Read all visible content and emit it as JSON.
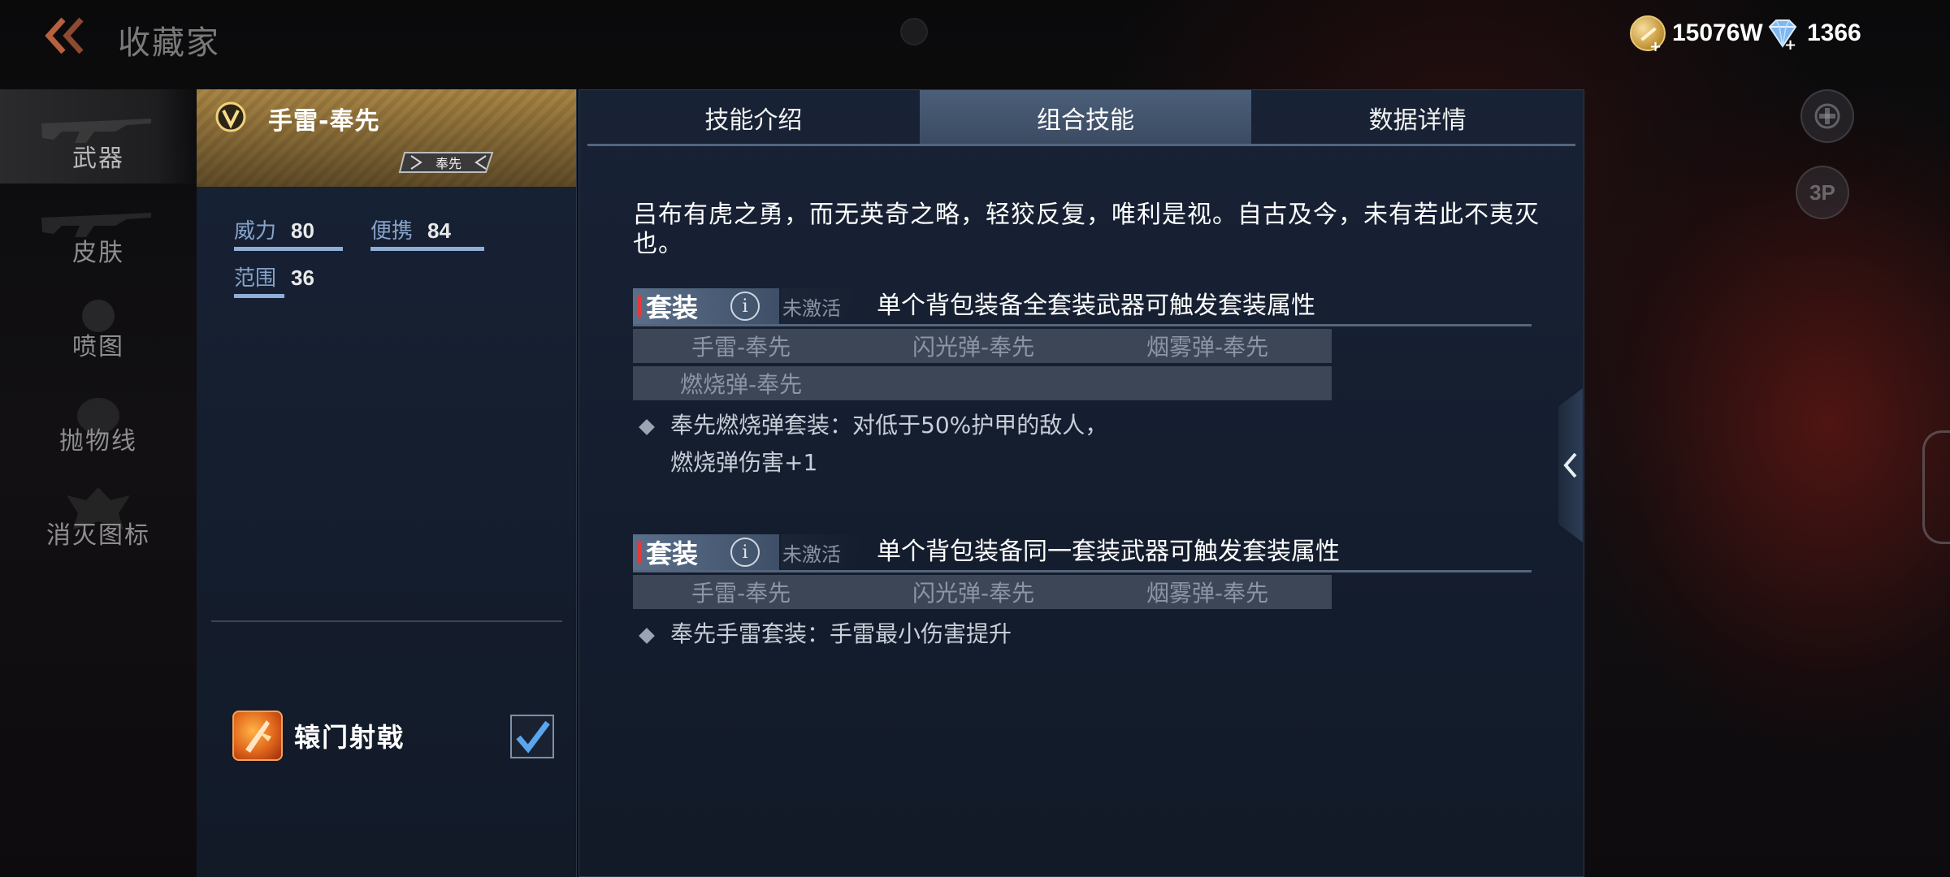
{
  "topbar": {
    "title": "收藏家",
    "gold_amount": "15076W",
    "gem_amount": "1366"
  },
  "categories": [
    {
      "label": "武器",
      "icon": "rifle-icon",
      "active": true
    },
    {
      "label": "皮肤",
      "icon": "rifle-icon",
      "active": false
    },
    {
      "label": "喷图",
      "icon": "spray-icon",
      "active": false
    },
    {
      "label": "抛物线",
      "icon": "grenade-icon",
      "active": false
    },
    {
      "label": "消灭图标",
      "icon": "emblem-icon",
      "active": false
    }
  ],
  "weapon": {
    "name": "手雷-奉先",
    "series": "奉先",
    "stats": [
      {
        "label": "威力",
        "value": "80"
      },
      {
        "label": "便携",
        "value": "84"
      },
      {
        "label": "范围",
        "value": "36"
      }
    ],
    "trait": {
      "name": "辕门射戟",
      "checked": true
    }
  },
  "tabs": [
    {
      "label": "技能介绍",
      "active": false
    },
    {
      "label": "组合技能",
      "active": true
    },
    {
      "label": "数据详情",
      "active": false
    }
  ],
  "description": "吕布有虎之勇，而无英奇之略，轻狡反复，唯利是视。自古及今，未有若此不夷灭也。",
  "sets": [
    {
      "label": "套装",
      "status": "未激活",
      "rule": "单个背包装备全套装武器可触发套装属性",
      "members": [
        [
          "手雷-奉先",
          "闪光弹-奉先",
          "烟雾弹-奉先"
        ],
        [
          "燃烧弹-奉先"
        ]
      ],
      "effect": "奉先燃烧弹套装：对低于50%护甲的敌人，",
      "effect_cont": "燃烧弹伤害+1"
    },
    {
      "label": "套装",
      "status": "未激活",
      "rule": "单个背包装备同一套装武器可触发套装属性",
      "members": [
        [
          "手雷-奉先",
          "闪光弹-奉先",
          "烟雾弹-奉先"
        ]
      ],
      "effect": "奉先手雷套装：手雷最小伤害提升"
    }
  ],
  "floating": {
    "view_button": "3P"
  },
  "colors": {
    "accent_gold": "#a98645",
    "tab_active": "#4c5f79",
    "stat_bar": "#8eaed6",
    "status_mark": "#e23a3a"
  }
}
